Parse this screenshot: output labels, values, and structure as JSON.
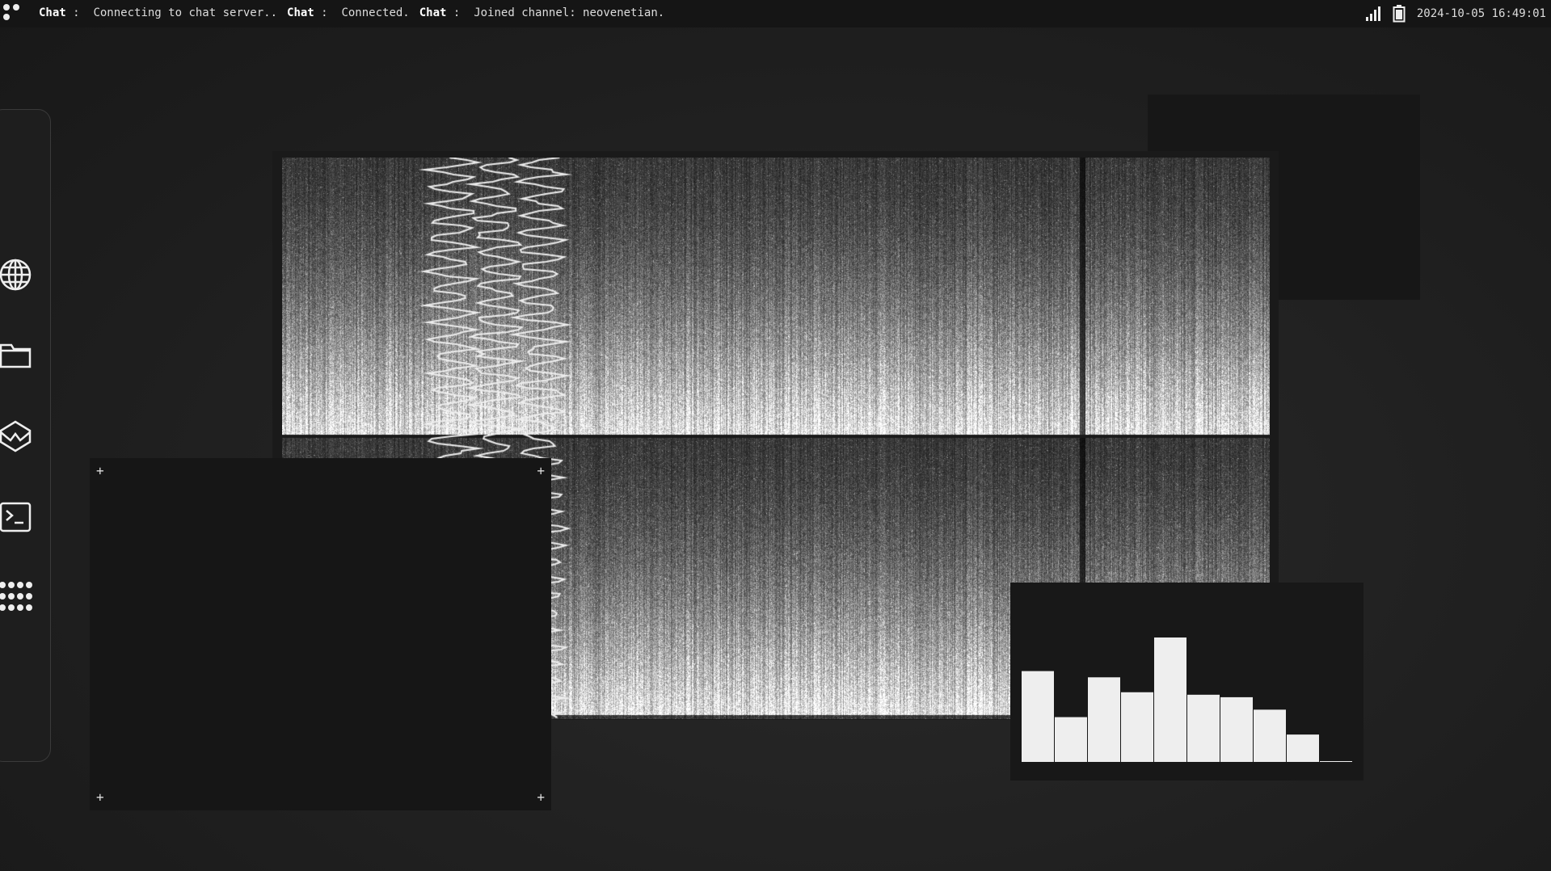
{
  "topbar": {
    "messages": [
      {
        "source": "Chat",
        "text": "Connecting to chat server.."
      },
      {
        "source": "Chat",
        "text": "Connected."
      },
      {
        "source": "Chat",
        "text": "Joined channel: neovenetian."
      }
    ],
    "datetime": "2024-10-05 16:49:01",
    "icons": [
      "signal-icon",
      "battery-icon"
    ]
  },
  "sidebar": {
    "items": [
      {
        "icon": "globe-icon",
        "name": "browser"
      },
      {
        "icon": "folder-icon",
        "name": "files"
      },
      {
        "icon": "cube-icon",
        "name": "3d-viewer"
      },
      {
        "icon": "terminal-icon",
        "name": "terminal"
      },
      {
        "icon": "apps-grid-icon",
        "name": "apps"
      }
    ]
  },
  "histogram": {
    "relative_values": [
      0.73,
      0.36,
      0.68,
      0.56,
      1.0,
      0.54,
      0.52,
      0.42,
      0.22,
      0.005
    ],
    "bar_color": "#eeeeee"
  },
  "colors": {
    "background": "#1d1d1d",
    "panel": "#161616",
    "text": "#dddddd"
  }
}
